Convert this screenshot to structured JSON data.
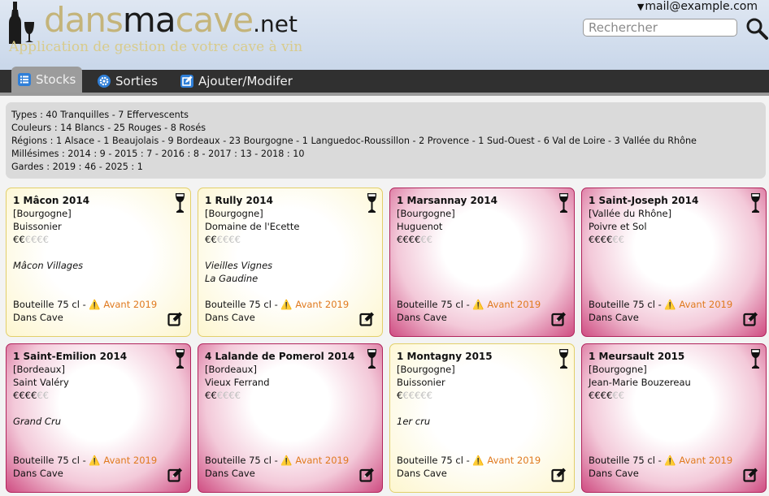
{
  "header": {
    "logo": {
      "dans": "dans",
      "ma": "ma",
      "cave": "cave",
      "net": ".net"
    },
    "tagline": "Application de gestion de votre cave à vin",
    "user_email": "mail@example.com",
    "search_placeholder": "Rechercher"
  },
  "nav": {
    "tabs": [
      {
        "label": "Stocks",
        "icon": "list-icon",
        "active": true
      },
      {
        "label": "Sorties",
        "icon": "gear-icon",
        "active": false
      },
      {
        "label": "Ajouter/Modifer",
        "icon": "edit-icon",
        "active": false
      }
    ]
  },
  "summary": {
    "types": "Types : 40 Tranquilles - 7 Effervescents",
    "couleurs": "Couleurs : 14 Blancs - 25 Rouges - 8 Rosés",
    "regions": "Régions : 1 Alsace - 1 Beaujolais - 9 Bordeaux - 23 Bourgogne - 1 Languedoc-Roussillon - 2 Provence - 1 Sud-Ouest - 6 Val de Loire - 3 Vallée du Rhône",
    "millesimes": "Millésimes : 2014 : 9 - 2015 : 7 - 2016 : 8 - 2017 : 13 - 2018 : 10",
    "gardes": "Gardes : 2019 : 46 - 2025 : 1"
  },
  "colors": {
    "white_wine_border": "#e2cf6a",
    "red_wine_border": "#b1245c",
    "warning": "#e07a1f"
  },
  "cards": [
    {
      "title": "1 Mâcon 2014",
      "region": "[Bourgogne]",
      "producer": "Buissonier",
      "price_on": "€€",
      "price_off": "€€€€",
      "notes1": "Mâcon Villages",
      "notes2": "",
      "format": "Bouteille 75 cl - ",
      "garde": "Avant 2019",
      "location": "Dans Cave",
      "color": "white"
    },
    {
      "title": "1 Rully 2014",
      "region": "[Bourgogne]",
      "producer": "Domaine de l'Ecette",
      "price_on": "€€",
      "price_off": "€€€€",
      "notes1": "Vieilles Vignes",
      "notes2": "La Gaudine",
      "format": "Bouteille 75 cl - ",
      "garde": "Avant 2019",
      "location": "Dans Cave",
      "color": "white"
    },
    {
      "title": "1 Marsannay 2014",
      "region": "[Bourgogne]",
      "producer": "Huguenot",
      "price_on": "€€€€",
      "price_off": "€€",
      "notes1": "",
      "notes2": "",
      "format": "Bouteille 75 cl - ",
      "garde": "Avant 2019",
      "location": "Dans Cave",
      "color": "red"
    },
    {
      "title": "1 Saint-Joseph 2014",
      "region": "[Vallée du Rhône]",
      "producer": "Poivre et Sol",
      "price_on": "€€€€",
      "price_off": "€€",
      "notes1": "",
      "notes2": "",
      "format": "Bouteille 75 cl - ",
      "garde": "Avant 2019",
      "location": "Dans Cave",
      "color": "red"
    },
    {
      "title": "1 Saint-Emilion 2014",
      "region": "[Bordeaux]",
      "producer": "Saint Valéry",
      "price_on": "€€€€",
      "price_off": "€€",
      "notes1": "Grand Cru",
      "notes2": "",
      "format": "Bouteille 75 cl - ",
      "garde": "Avant 2019",
      "location": "Dans Cave",
      "color": "red"
    },
    {
      "title": "4 Lalande de Pomerol 2014",
      "region": "[Bordeaux]",
      "producer": "Vieux Ferrand",
      "price_on": "€€",
      "price_off": "€€€€",
      "notes1": "",
      "notes2": "",
      "format": "Bouteille 75 cl - ",
      "garde": "Avant 2019",
      "location": "Dans Cave",
      "color": "red"
    },
    {
      "title": "1 Montagny 2015",
      "region": "[Bourgogne]",
      "producer": "Buissonier",
      "price_on": "€",
      "price_off": "€€€€€",
      "notes1": "1er cru",
      "notes2": "",
      "format": "Bouteille 75 cl - ",
      "garde": "Avant 2019",
      "location": "Dans Cave",
      "color": "white"
    },
    {
      "title": "1 Meursault 2015",
      "region": "[Bourgogne]",
      "producer": "Jean-Marie Bouzereau",
      "price_on": "€€€€",
      "price_off": "€€",
      "notes1": "",
      "notes2": "",
      "format": "Bouteille 75 cl - ",
      "garde": "Avant 2019",
      "location": "Dans Cave",
      "color": "red"
    }
  ]
}
